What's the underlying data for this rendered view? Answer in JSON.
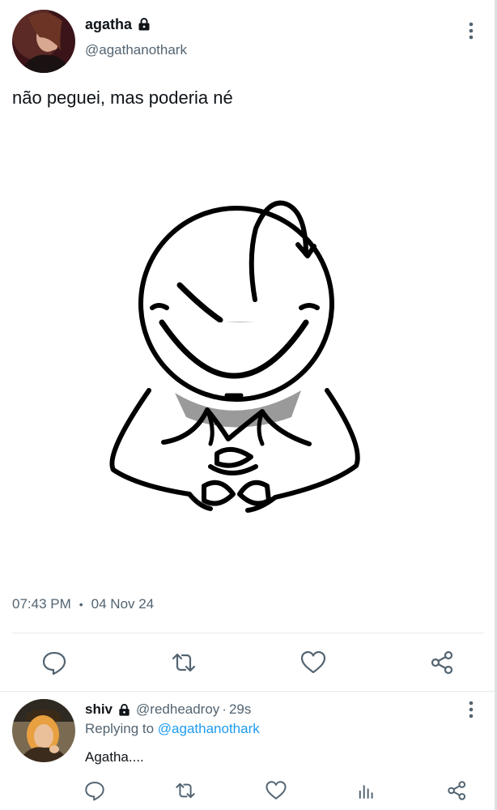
{
  "tweet": {
    "display_name": "agatha",
    "handle": "@agathanothark",
    "text": "não peguei, mas poderia né",
    "time": "07:43 PM",
    "separator": "•",
    "date": "04 Nov 24",
    "icons": [
      "lock-icon",
      "more-icon",
      "reply-icon",
      "retweet-icon",
      "like-icon",
      "share-icon"
    ]
  },
  "reply": {
    "display_name": "shiv",
    "handle": "@redheadroy",
    "separator": "·",
    "time": "29s",
    "replying_prefix": "Replying to ",
    "replying_mention": "@agathanothark",
    "text": "Agatha....",
    "icons": [
      "lock-icon",
      "more-icon",
      "reply-icon",
      "retweet-icon",
      "like-icon",
      "analytics-icon",
      "share-icon"
    ]
  },
  "colors": {
    "text": "#0f1419",
    "secondary": "#536471",
    "link": "#1d9bf0",
    "divider": "#e6e9eb"
  }
}
